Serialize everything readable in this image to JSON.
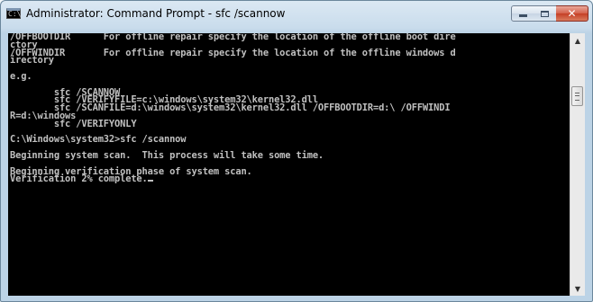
{
  "window": {
    "title": "Administrator: Command Prompt - sfc  /scannow",
    "app_icon_text": "C:\\"
  },
  "controls": {
    "minimize_icon": "minimize-icon",
    "maximize_icon": "maximize-icon",
    "close_icon": "close-icon",
    "close_glyph": "✕"
  },
  "console": {
    "lines": [
      "/OFFBOOTDIR      For offline repair specify the location of the offline boot dire",
      "ctory",
      "/OFFWINDIR       For offline repair specify the location of the offline windows d",
      "irectory",
      "",
      "e.g.",
      "",
      "        sfc /SCANNOW",
      "        sfc /VERIFYFILE=c:\\windows\\system32\\kernel32.dll",
      "        sfc /SCANFILE=d:\\windows\\system32\\kernel32.dll /OFFBOOTDIR=d:\\ /OFFWINDI",
      "R=d:\\windows",
      "        sfc /VERIFYONLY",
      "",
      "C:\\Windows\\system32>sfc /scannow",
      "",
      "Beginning system scan.  This process will take some time.",
      "",
      "Beginning verification phase of system scan.",
      "Verification 2% complete."
    ],
    "text_color": "#c0c0c0",
    "background": "#000000"
  },
  "scrollbar": {
    "up_glyph": "▲",
    "down_glyph": "▼",
    "position_fraction": 0.18
  }
}
